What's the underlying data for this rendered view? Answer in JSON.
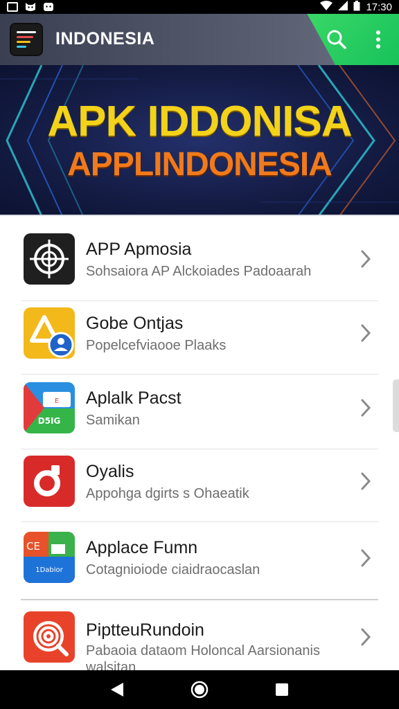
{
  "status_bar": {
    "time": "17:30",
    "left_icons": [
      "image-icon",
      "cat-icon",
      "face-icon"
    ],
    "right_icons": [
      "wifi-icon",
      "signal-icon",
      "battery-icon"
    ]
  },
  "app_bar": {
    "title": "INDONESIA",
    "search_icon": "search-icon",
    "more_icon": "more-vert-icon",
    "accent_color": "#22c95f"
  },
  "banner": {
    "title": "APK IDDONISA",
    "subtitle": "APPLINDONESIA",
    "title_color": "#f3d21a",
    "subtitle_color": "#f07a1c"
  },
  "apps": [
    {
      "title": "APP Apmosia",
      "subtitle": "Sohsaiora AP Alckoiades Padoaarah",
      "icon": "crosshair-icon"
    },
    {
      "title": "Gobe Ontjas",
      "subtitle": "Popelcefviaooe Plaaks",
      "icon": "drive-user-icon"
    },
    {
      "title": "Aplalk Pacst",
      "subtitle": "Samikan",
      "icon": "card-icon"
    },
    {
      "title": "Oyalis",
      "subtitle": "Appohga dgirts s Ohaeatik",
      "icon": "red-logo-icon"
    },
    {
      "title": "Applace Fumn",
      "subtitle": "Cotagnioiode ciaidraocaslan",
      "icon": "tiles-icon"
    },
    {
      "title": "PiptteuRundoin",
      "subtitle": "Pabaoia dataom Holoncal Aarsionanis",
      "subtitle_2": "walsitan",
      "icon": "spiral-icon"
    }
  ],
  "nav_bar": {
    "back_icon": "back-triangle-icon",
    "home_icon": "home-circle-icon",
    "recents_icon": "recents-square-icon"
  }
}
